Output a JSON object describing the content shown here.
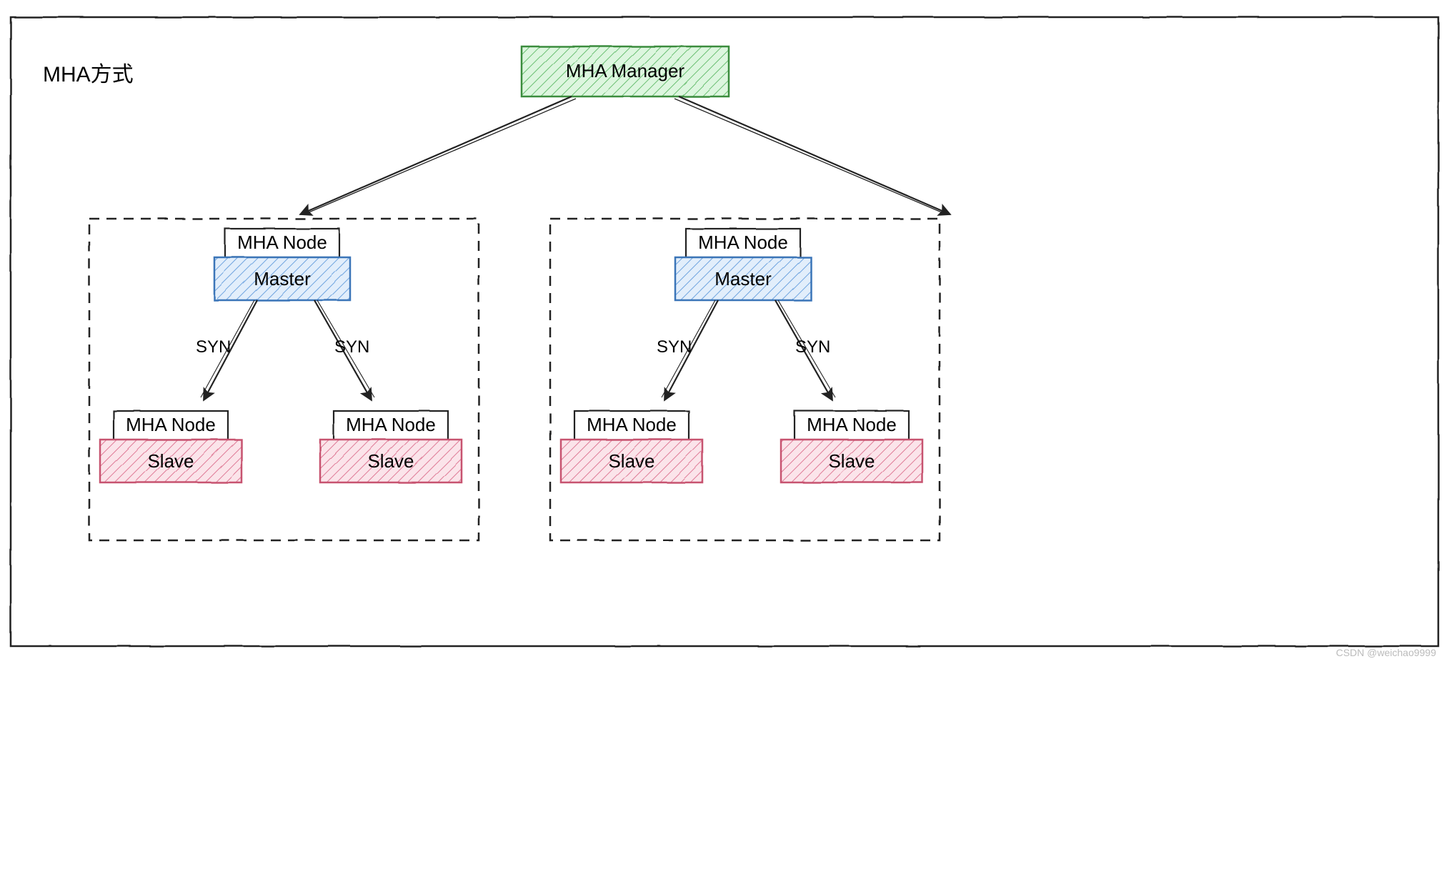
{
  "title": "MHA方式",
  "manager": {
    "label": "MHA Manager"
  },
  "clusters": [
    {
      "master": {
        "node_label": "MHA Node",
        "label": "Master"
      },
      "slave_left": {
        "node_label": "MHA Node",
        "label": "Slave",
        "syn": "SYN"
      },
      "slave_right": {
        "node_label": "MHA Node",
        "label": "Slave",
        "syn": "SYN"
      }
    },
    {
      "master": {
        "node_label": "MHA Node",
        "label": "Master"
      },
      "slave_left": {
        "node_label": "MHA Node",
        "label": "Slave",
        "syn": "SYN"
      },
      "slave_right": {
        "node_label": "MHA Node",
        "label": "Slave",
        "syn": "SYN"
      }
    }
  ],
  "watermark": "CSDN @weichao9999",
  "colors": {
    "green_fill": "#8fd89a",
    "green_stroke": "#3a8c3d",
    "blue_fill": "#a9cef3",
    "blue_stroke": "#3b74b8",
    "pink_fill": "#f5b4c6",
    "pink_stroke": "#c7536f",
    "ink": "#222"
  }
}
